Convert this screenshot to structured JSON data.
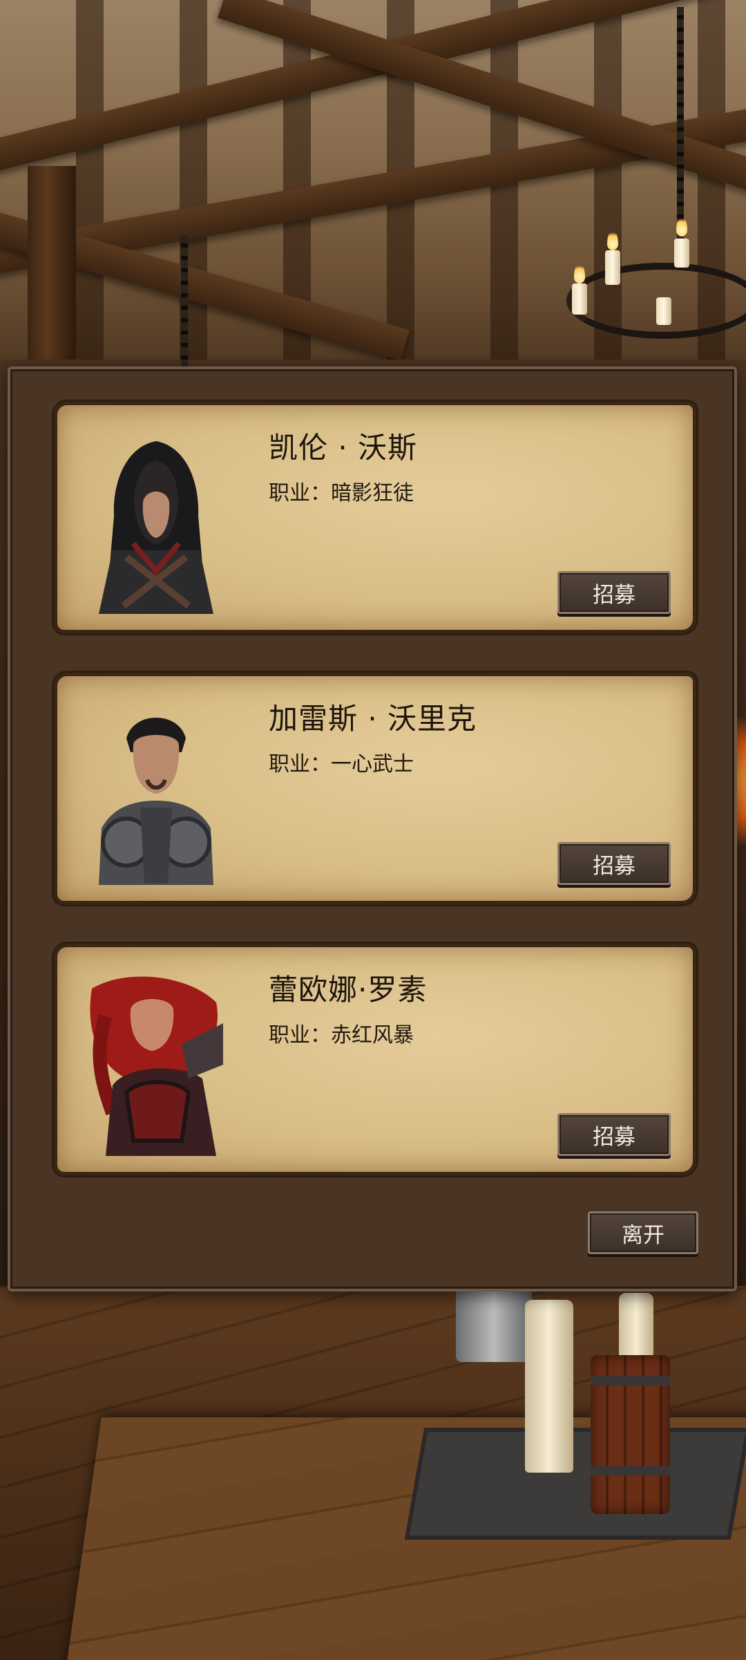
{
  "background": {
    "scene": "tavern-interior"
  },
  "dialog": {
    "heroes": [
      {
        "name": "凯伦 · 沃斯",
        "class_label": "职业：暗影狂徒",
        "recruit_label": "招募",
        "portrait": "hooded-rogue-portrait"
      },
      {
        "name": "加雷斯 · 沃里克",
        "class_label": "职业：一心武士",
        "recruit_label": "招募",
        "portrait": "armored-warrior-portrait"
      },
      {
        "name": "蕾欧娜·罗素",
        "class_label": "职业：赤红风暴",
        "recruit_label": "招募",
        "portrait": "red-haired-warrior-portrait"
      }
    ],
    "leave_label": "离开"
  },
  "colors": {
    "dialog_bg": "#4a3423",
    "parchment": "#dcc08a",
    "button_bg": "#4a3c33",
    "button_text": "#f2ece3"
  }
}
